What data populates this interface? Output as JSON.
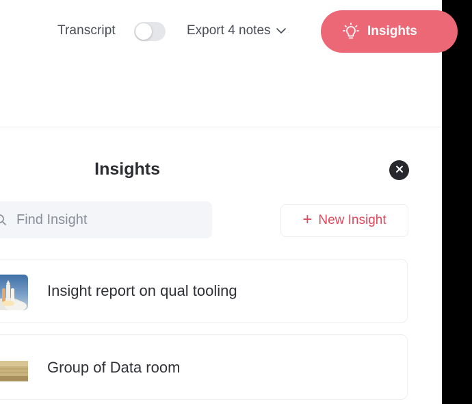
{
  "toolbar": {
    "transcript_label": "Transcript",
    "transcript_toggle_on": false,
    "export_label": "Export 4 notes",
    "insights_label": "Insights"
  },
  "panel": {
    "title": "Insights",
    "search": {
      "placeholder": "Find Insight",
      "value": ""
    },
    "new_insight_label": "New Insight",
    "items": [
      {
        "title": "Insight report on qual tooling",
        "thumbnail": "rocket-launch-image"
      },
      {
        "title": "Group of Data room",
        "thumbnail": "folder-stack-image"
      }
    ]
  },
  "colors": {
    "accent": "#ec6876",
    "accent_text": "#e0485c",
    "close_button": "#26282e",
    "search_bg": "#f3f5f8"
  },
  "icons": {
    "insights": "lightbulb-icon",
    "export": "chevron-down-icon",
    "close": "close-icon",
    "search": "search-icon",
    "new": "plus-icon"
  }
}
